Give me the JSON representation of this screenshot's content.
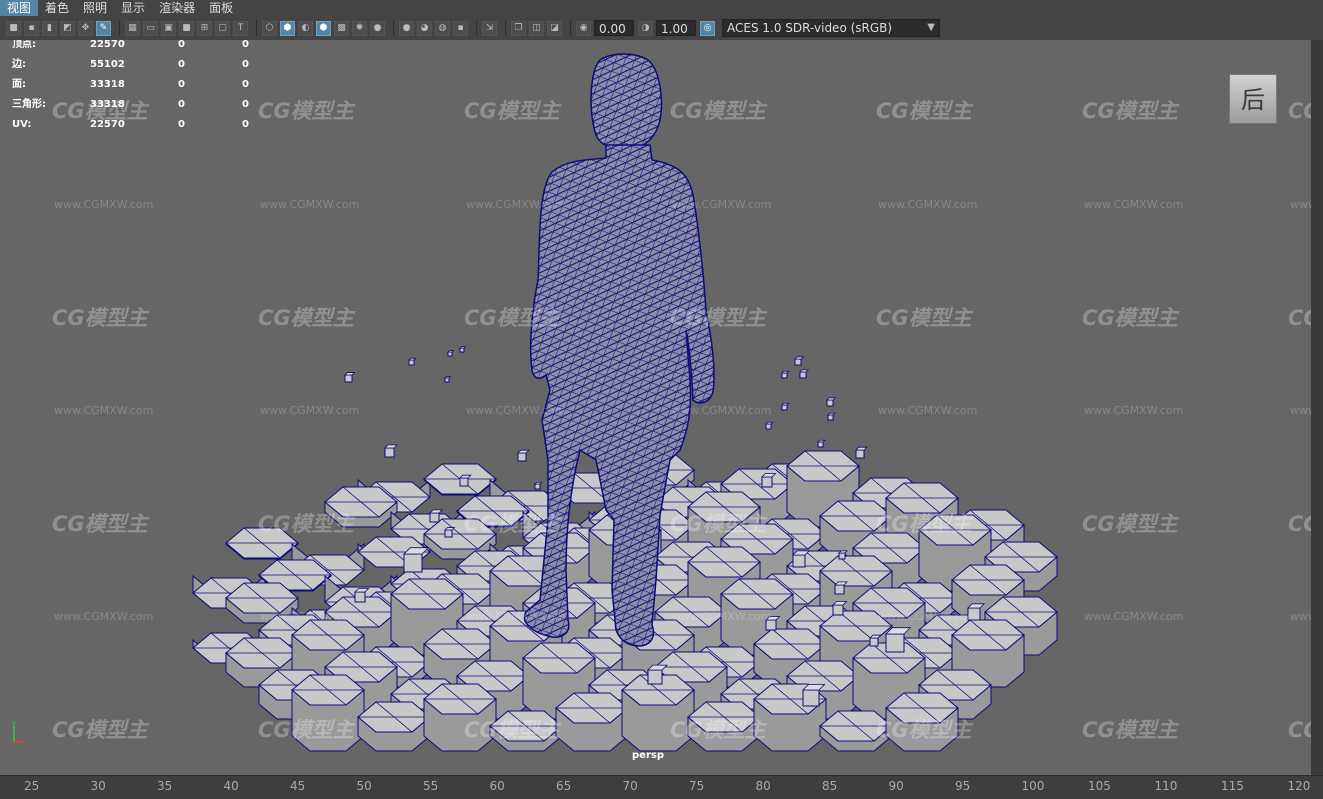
{
  "menu": [
    "视图",
    "着色",
    "照明",
    "显示",
    "渲染器",
    "面板"
  ],
  "active_menu_index": 0,
  "toolbar": {
    "exposure_value": "0.00",
    "gamma_value": "1.00",
    "color_space": "ACES 1.0 SDR-video (sRGB)"
  },
  "hud": [
    {
      "label": "顶点:",
      "v1": "22570",
      "v2": "0",
      "v3": "0"
    },
    {
      "label": "边:",
      "v1": "55102",
      "v2": "0",
      "v3": "0"
    },
    {
      "label": "面:",
      "v1": "33318",
      "v2": "0",
      "v3": "0"
    },
    {
      "label": "三角形:",
      "v1": "33318",
      "v2": "0",
      "v3": "0"
    },
    {
      "label": "UV:",
      "v1": "22570",
      "v2": "0",
      "v3": "0"
    }
  ],
  "viewcube_label": "后",
  "camera_label": "persp",
  "axis": {
    "x": "x",
    "y": "y"
  },
  "watermark": {
    "brand": "CG模型主",
    "url": "www.CGMXW.com"
  },
  "timeline_ticks": [
    "25",
    "30",
    "35",
    "40",
    "45",
    "50",
    "55",
    "60",
    "65",
    "70",
    "75",
    "80",
    "85",
    "90",
    "95",
    "100",
    "105",
    "110",
    "115",
    "120"
  ],
  "colors": {
    "viewport_bg": "#666666",
    "wireframe": "#0b0b7a",
    "floor_fill": "#c8c8c8",
    "active_menu": "#5285a6"
  }
}
